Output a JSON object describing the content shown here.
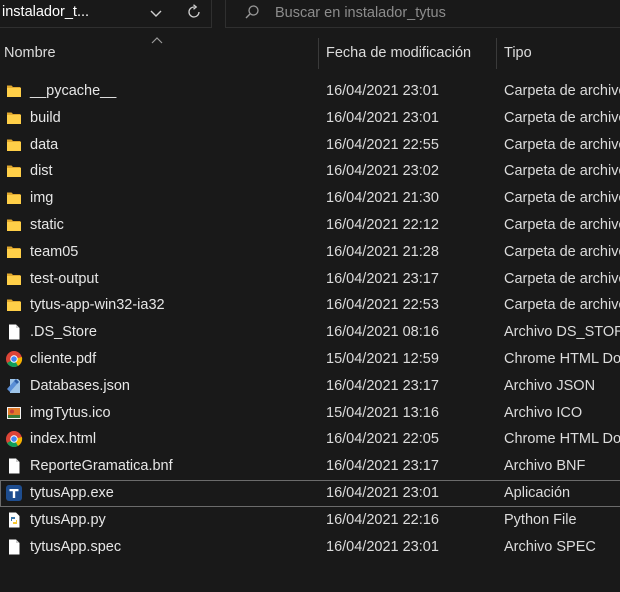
{
  "toolbar": {
    "path_label": "instalador_t...",
    "search_placeholder": "Buscar en instalador_tytus"
  },
  "columns": {
    "name": "Nombre",
    "date": "Fecha de modificación",
    "type": "Tipo"
  },
  "files": [
    {
      "name": "__pycache__",
      "date": "16/04/2021 23:01",
      "type": "Carpeta de archivos",
      "icon": "folder-icon"
    },
    {
      "name": "build",
      "date": "16/04/2021 23:01",
      "type": "Carpeta de archivos",
      "icon": "folder-icon"
    },
    {
      "name": "data",
      "date": "16/04/2021 22:55",
      "type": "Carpeta de archivos",
      "icon": "folder-icon"
    },
    {
      "name": "dist",
      "date": "16/04/2021 23:02",
      "type": "Carpeta de archivos",
      "icon": "folder-icon"
    },
    {
      "name": "img",
      "date": "16/04/2021 21:30",
      "type": "Carpeta de archivos",
      "icon": "folder-icon"
    },
    {
      "name": "static",
      "date": "16/04/2021 22:12",
      "type": "Carpeta de archivos",
      "icon": "folder-icon"
    },
    {
      "name": "team05",
      "date": "16/04/2021 21:28",
      "type": "Carpeta de archivos",
      "icon": "folder-icon"
    },
    {
      "name": "test-output",
      "date": "16/04/2021 23:17",
      "type": "Carpeta de archivos",
      "icon": "folder-icon"
    },
    {
      "name": "tytus-app-win32-ia32",
      "date": "16/04/2021 22:53",
      "type": "Carpeta de archivos",
      "icon": "folder-icon"
    },
    {
      "name": ".DS_Store",
      "date": "16/04/2021 08:16",
      "type": "Archivo DS_STORE",
      "icon": "blank-file-icon"
    },
    {
      "name": "cliente.pdf",
      "date": "15/04/2021 12:59",
      "type": "Chrome HTML Document",
      "icon": "chrome-icon"
    },
    {
      "name": "Databases.json",
      "date": "16/04/2021 23:17",
      "type": "Archivo JSON",
      "icon": "json-file-icon"
    },
    {
      "name": "imgTytus.ico",
      "date": "15/04/2021 13:16",
      "type": "Archivo ICO",
      "icon": "ico-image-icon"
    },
    {
      "name": "index.html",
      "date": "16/04/2021 22:05",
      "type": "Chrome HTML Document",
      "icon": "chrome-icon"
    },
    {
      "name": "ReporteGramatica.bnf",
      "date": "16/04/2021 23:17",
      "type": "Archivo BNF",
      "icon": "blank-file-icon"
    },
    {
      "name": "tytusApp.exe",
      "date": "16/04/2021 23:01",
      "type": "Aplicación",
      "icon": "tytus-app-icon",
      "selected": true
    },
    {
      "name": "tytusApp.py",
      "date": "16/04/2021 22:16",
      "type": "Python File",
      "icon": "python-file-icon"
    },
    {
      "name": "tytusApp.spec",
      "date": "16/04/2021 23:01",
      "type": "Archivo SPEC",
      "icon": "blank-file-icon"
    }
  ]
}
